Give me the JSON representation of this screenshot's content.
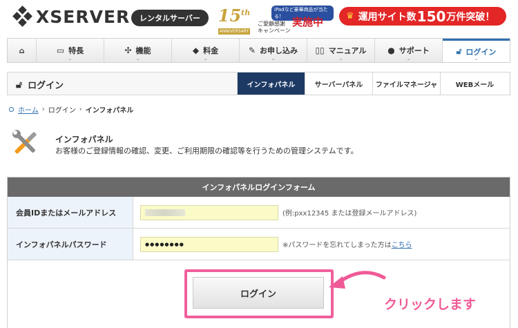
{
  "header": {
    "logo_text": "XSERVER",
    "rental_badge": "レンタルサーバー",
    "anniversary_number": "15",
    "anniversary_suffix": "th",
    "anniversary_label": "ANNIVERSARY",
    "campaign_tag": "iPadなど豪華商品が当たる！",
    "campaign_line1": "ご愛顧感謝",
    "campaign_line2": "キャンペーン",
    "campaign_status": "実施中",
    "promo_prefix": "運用サイト数",
    "promo_number": "150",
    "promo_suffix": "万件突破！"
  },
  "nav": {
    "items": [
      {
        "label": "",
        "icon": "home-icon"
      },
      {
        "label": "特長",
        "icon": "monitor-icon"
      },
      {
        "label": "機能",
        "icon": "tools-icon"
      },
      {
        "label": "料金",
        "icon": "tag-icon"
      },
      {
        "label": "お申し込み",
        "icon": "pencil-icon"
      },
      {
        "label": "マニュアル",
        "icon": "book-icon"
      },
      {
        "label": "サポート",
        "icon": "person-icon"
      },
      {
        "label": "ログイン",
        "icon": "lock-icon"
      }
    ],
    "active": "ログイン"
  },
  "subnav": {
    "title": "ログイン",
    "tabs": [
      "インフォパネル",
      "サーバーパネル",
      "ファイルマネージャ",
      "WEBメール"
    ],
    "active": "インフォパネル"
  },
  "breadcrumb": {
    "home": "ホーム",
    "login": "ログイン",
    "current": "インフォパネル"
  },
  "intro": {
    "title": "インフォパネル",
    "description": "お客様のご登録情報の確認、変更、ご利用期限の確認等を行うための管理システムです。"
  },
  "form": {
    "heading": "インフォパネルログインフォーム",
    "id_label": "会員IDまたはメールアドレス",
    "id_hint": "(例:pxx12345 または登録メールアドレス)",
    "password_label": "インフォパネルパスワード",
    "password_value": "●●●●●●●●",
    "forgot_prefix": "※パスワードを忘れてしまった方は",
    "forgot_link": "こちら",
    "login_button": "ログイン"
  },
  "annotation": {
    "text": "クリックします",
    "color": "#ef5a96"
  },
  "colors": {
    "accent": "#2e6fae",
    "active_tab": "#1d3a64",
    "promo": "#e32626",
    "input_bg": "#fbfbc8"
  }
}
